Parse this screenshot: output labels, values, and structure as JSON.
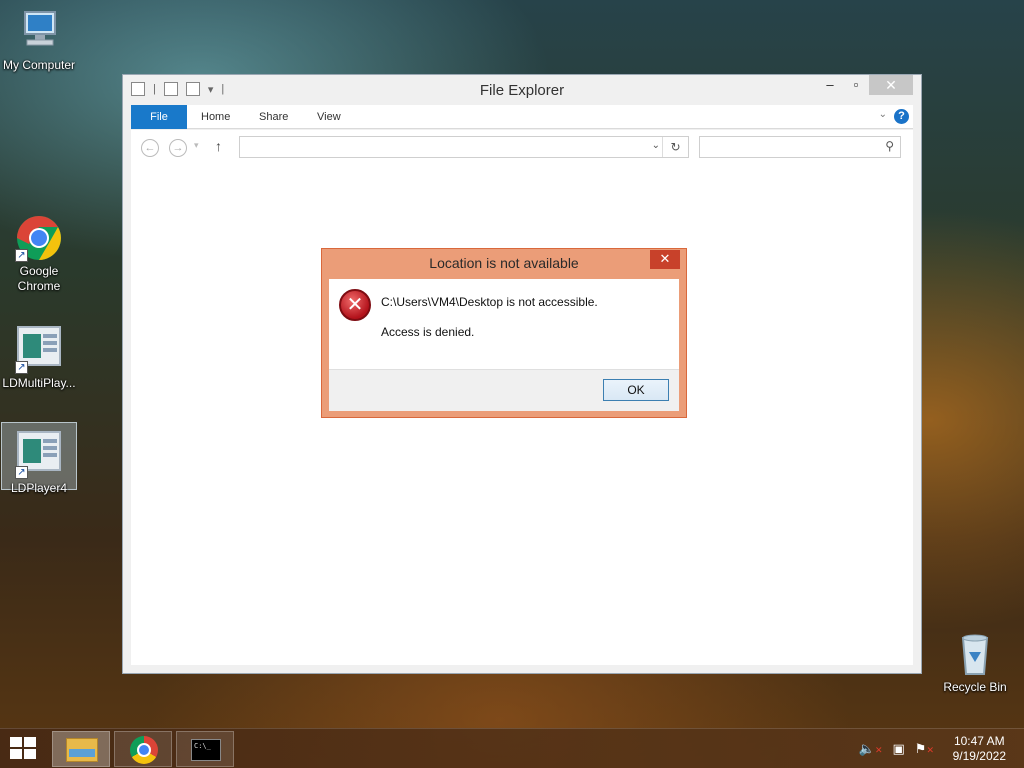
{
  "desktop": {
    "icons": [
      {
        "label": "My Computer"
      },
      {
        "label": "Google Chrome"
      },
      {
        "label": "LDMultiPlay..."
      },
      {
        "label": "LDPlayer4"
      },
      {
        "label": "Recycle Bin"
      }
    ]
  },
  "explorer": {
    "title": "File Explorer",
    "tabs": [
      "File",
      "Home",
      "Share",
      "View"
    ],
    "address_value": "",
    "search_placeholder": ""
  },
  "dialog": {
    "title": "Location is not available",
    "message": "C:\\Users\\VM4\\Desktop is not accessible.",
    "detail": "Access is denied.",
    "ok_label": "OK"
  },
  "taskbar": {
    "time": "10:47 AM",
    "date": "9/19/2022"
  },
  "colors": {
    "ribbon_file_tab": "#1979ca",
    "dialog_frame": "#eb9d78",
    "dialog_close": "#c8412a"
  },
  "icons": [
    "computer-icon",
    "chrome-icon",
    "ldplayer-icon",
    "recycle-bin-icon",
    "error-icon",
    "windows-start-icon",
    "folder-icon",
    "cmd-icon",
    "volume-muted-icon",
    "network-icon",
    "action-center-icon"
  ]
}
